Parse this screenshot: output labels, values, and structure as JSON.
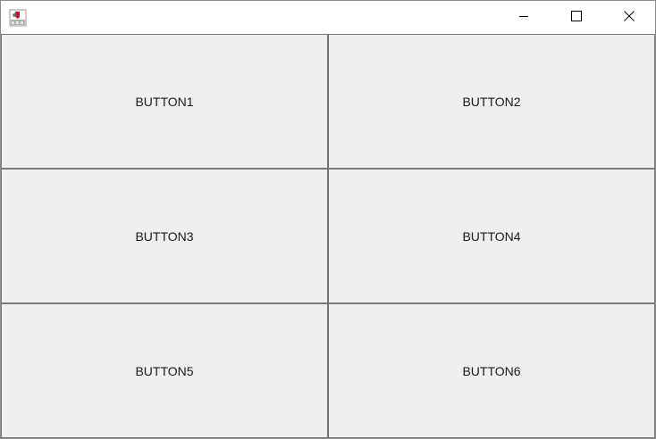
{
  "window": {
    "controls": {
      "minimize_icon": "minimize-icon",
      "maximize_icon": "maximize-icon",
      "close_icon": "close-icon"
    },
    "app_icon": "java-app-icon"
  },
  "grid": {
    "buttons": [
      {
        "label": "BUTTON1"
      },
      {
        "label": "BUTTON2"
      },
      {
        "label": "BUTTON3"
      },
      {
        "label": "BUTTON4"
      },
      {
        "label": "BUTTON5"
      },
      {
        "label": "BUTTON6"
      }
    ]
  },
  "colors": {
    "button_face": "#efefef",
    "button_border": "#7a7a7a",
    "titlebar": "#ffffff"
  }
}
